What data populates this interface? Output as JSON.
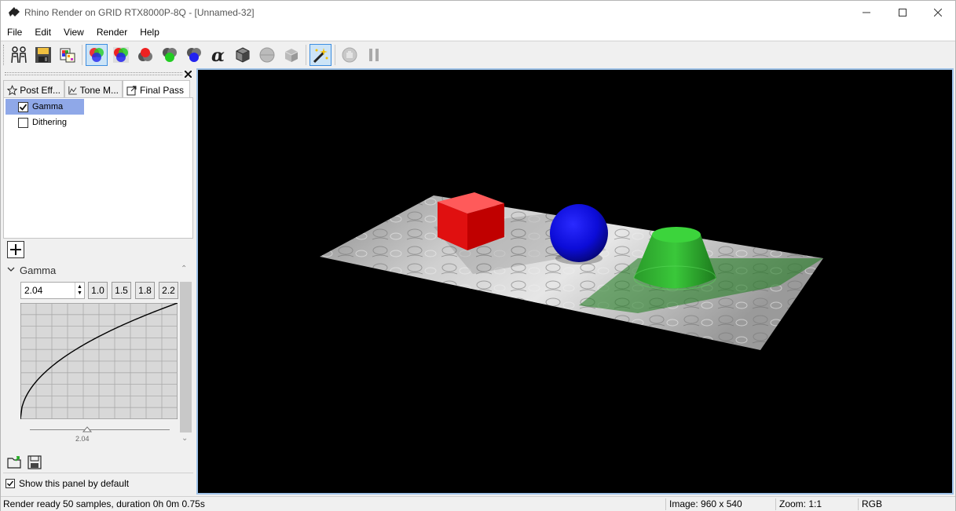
{
  "window": {
    "title": "Rhino Render on GRID RTX8000P-8Q - [Unnamed-32]"
  },
  "menu": [
    "File",
    "Edit",
    "View",
    "Render",
    "Help"
  ],
  "toolbar": {
    "icons": [
      "render-group-icon",
      "save-icon",
      "color-palette-icon",
      "rgb-channels-icon",
      "rgb-channels-alt-icon",
      "red-channel-icon",
      "green-channel-icon",
      "blue-channel-icon",
      "alpha-channel-icon",
      "depth-channel-icon",
      "sphere-channel-icon",
      "cube-channel-icon",
      "post-effects-wand-icon",
      "stop-icon",
      "pause-icon"
    ]
  },
  "panel": {
    "tabs": [
      "Post Eff...",
      "Tone M...",
      "Final Pass"
    ],
    "items": [
      {
        "label": "Gamma",
        "checked": true,
        "selected": true
      },
      {
        "label": "Dithering",
        "checked": false,
        "selected": false
      }
    ],
    "section_title": "Gamma",
    "gamma_value": "2.04",
    "presets": [
      "1.0",
      "1.5",
      "1.8",
      "2.2"
    ],
    "slider_value_label": "2.04",
    "gamma_fraction": 0.41,
    "show_default_label": "Show this panel by default",
    "show_default_checked": true
  },
  "status": {
    "message": "Render ready 50 samples, duration 0h 0m 0.75s",
    "image_size": "Image: 960 x 540",
    "zoom": "Zoom: 1:1",
    "channel": "RGB"
  },
  "colors": {
    "accent": "#3d8ee0",
    "selection": "#8fa8e8",
    "cube": "#ff1a1a",
    "sphere": "#1010e0",
    "cone": "#22b022"
  }
}
